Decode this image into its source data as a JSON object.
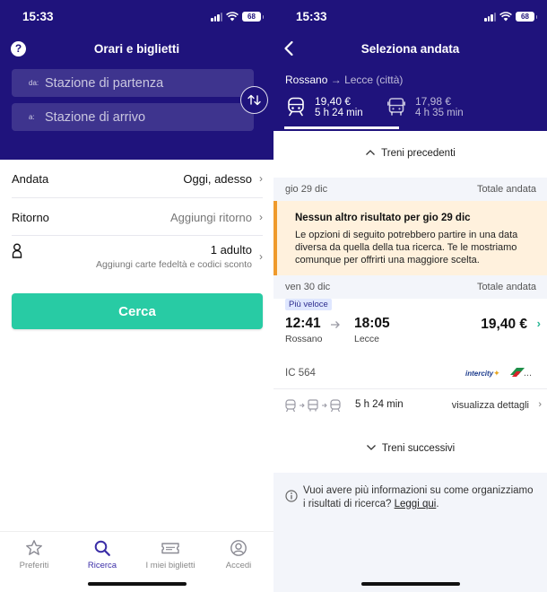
{
  "left": {
    "status": {
      "time": "15:33",
      "battery": "68"
    },
    "header": {
      "title": "Orari e biglietti"
    },
    "search": {
      "from_prefix": "da:",
      "from_placeholder": "Stazione di partenza",
      "to_prefix": "a:",
      "to_placeholder": "Stazione di arrivo"
    },
    "rows": {
      "andata_label": "Andata",
      "andata_value": "Oggi, adesso",
      "ritorno_label": "Ritorno",
      "ritorno_value": "Aggiungi ritorno",
      "passengers_value": "1 adulto",
      "passengers_sub": "Aggiungi carte fedeltà e codici sconto"
    },
    "search_button": "Cerca",
    "tabs": [
      {
        "label": "Preferiti",
        "icon": "star-icon"
      },
      {
        "label": "Ricerca",
        "icon": "search-icon"
      },
      {
        "label": "I miei biglietti",
        "icon": "ticket-icon"
      },
      {
        "label": "Accedi",
        "icon": "user-icon"
      }
    ],
    "active_tab": "Ricerca"
  },
  "right": {
    "status": {
      "time": "15:33",
      "battery": "68"
    },
    "header": {
      "title": "Seleziona andata"
    },
    "route": {
      "from": "Rossano",
      "arrow": "→",
      "to": "Lecce (città)"
    },
    "modes": [
      {
        "name": "train-icon",
        "price": "19,40 €",
        "duration": "5 h 24 min"
      },
      {
        "name": "bus-icon",
        "price": "17,98 €",
        "duration": "4 h 35 min"
      }
    ],
    "earlier_label": "Treni precedenti",
    "day1": {
      "date": "gio 29 dic",
      "total": "Totale andata"
    },
    "notice": {
      "title": "Nessun altro risultato per gio 29 dic",
      "body": "Le opzioni di seguito potrebbero partire in una data diversa da quella della tua ricerca. Te le mostriamo comunque per offrirti una maggiore scelta."
    },
    "day2": {
      "date": "ven 30 dic",
      "total": "Totale andata"
    },
    "journey": {
      "tag": "Più veloce",
      "depart_time": "12:41",
      "depart_station": "Rossano",
      "arrive_time": "18:05",
      "arrive_station": "Lecce",
      "price": "19,40 €",
      "train_code": "IC 564",
      "operator_logo_text": "intercity",
      "more": "...",
      "duration": "5 h 24 min",
      "details_link": "visualizza dettagli"
    },
    "later_label": "Treni successivi",
    "info": {
      "text": "Vuoi avere più informazioni su come organizziamo i risultati di ricerca? ",
      "link": "Leggi qui",
      "end": "."
    },
    "colors": {
      "brand": "#1f137c",
      "accent": "#28cba4",
      "warning": "#ef9a2c"
    }
  }
}
